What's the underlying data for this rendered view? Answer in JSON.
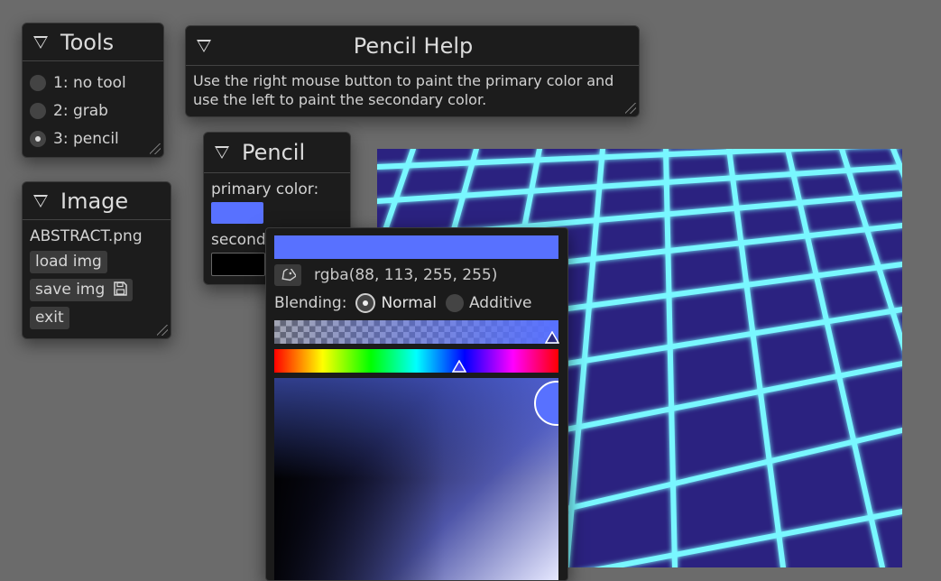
{
  "tools": {
    "title": "Tools",
    "items": [
      {
        "label": "1: no tool",
        "selected": false
      },
      {
        "label": "2: grab",
        "selected": false
      },
      {
        "label": "3: pencil",
        "selected": true
      }
    ]
  },
  "help": {
    "title": "Pencil Help",
    "line1": "Use the right mouse button to paint the primary color and",
    "line2": "use the left to paint the secondary color."
  },
  "image": {
    "title": "Image",
    "filename": "ABSTRACT.png",
    "load_label": "load img",
    "save_label": "save img",
    "exit_label": "exit"
  },
  "pencil": {
    "title": "Pencil",
    "primary_label": "primary color:",
    "secondary_label": "second",
    "primary_color": "#5871ff",
    "secondary_color": "#000000"
  },
  "picker": {
    "rgba_text": "rgba(88, 113, 255, 255)",
    "blending_label": "Blending:",
    "normal_label": "Normal",
    "additive_label": "Additive",
    "blending_selected": "Normal",
    "color": "#5871ff"
  },
  "colors": {
    "background": "#6b6b6b",
    "panel": "#1c1c1c",
    "grid_line": "#7ff6ff",
    "grid_cell": "#8b5cf6"
  }
}
